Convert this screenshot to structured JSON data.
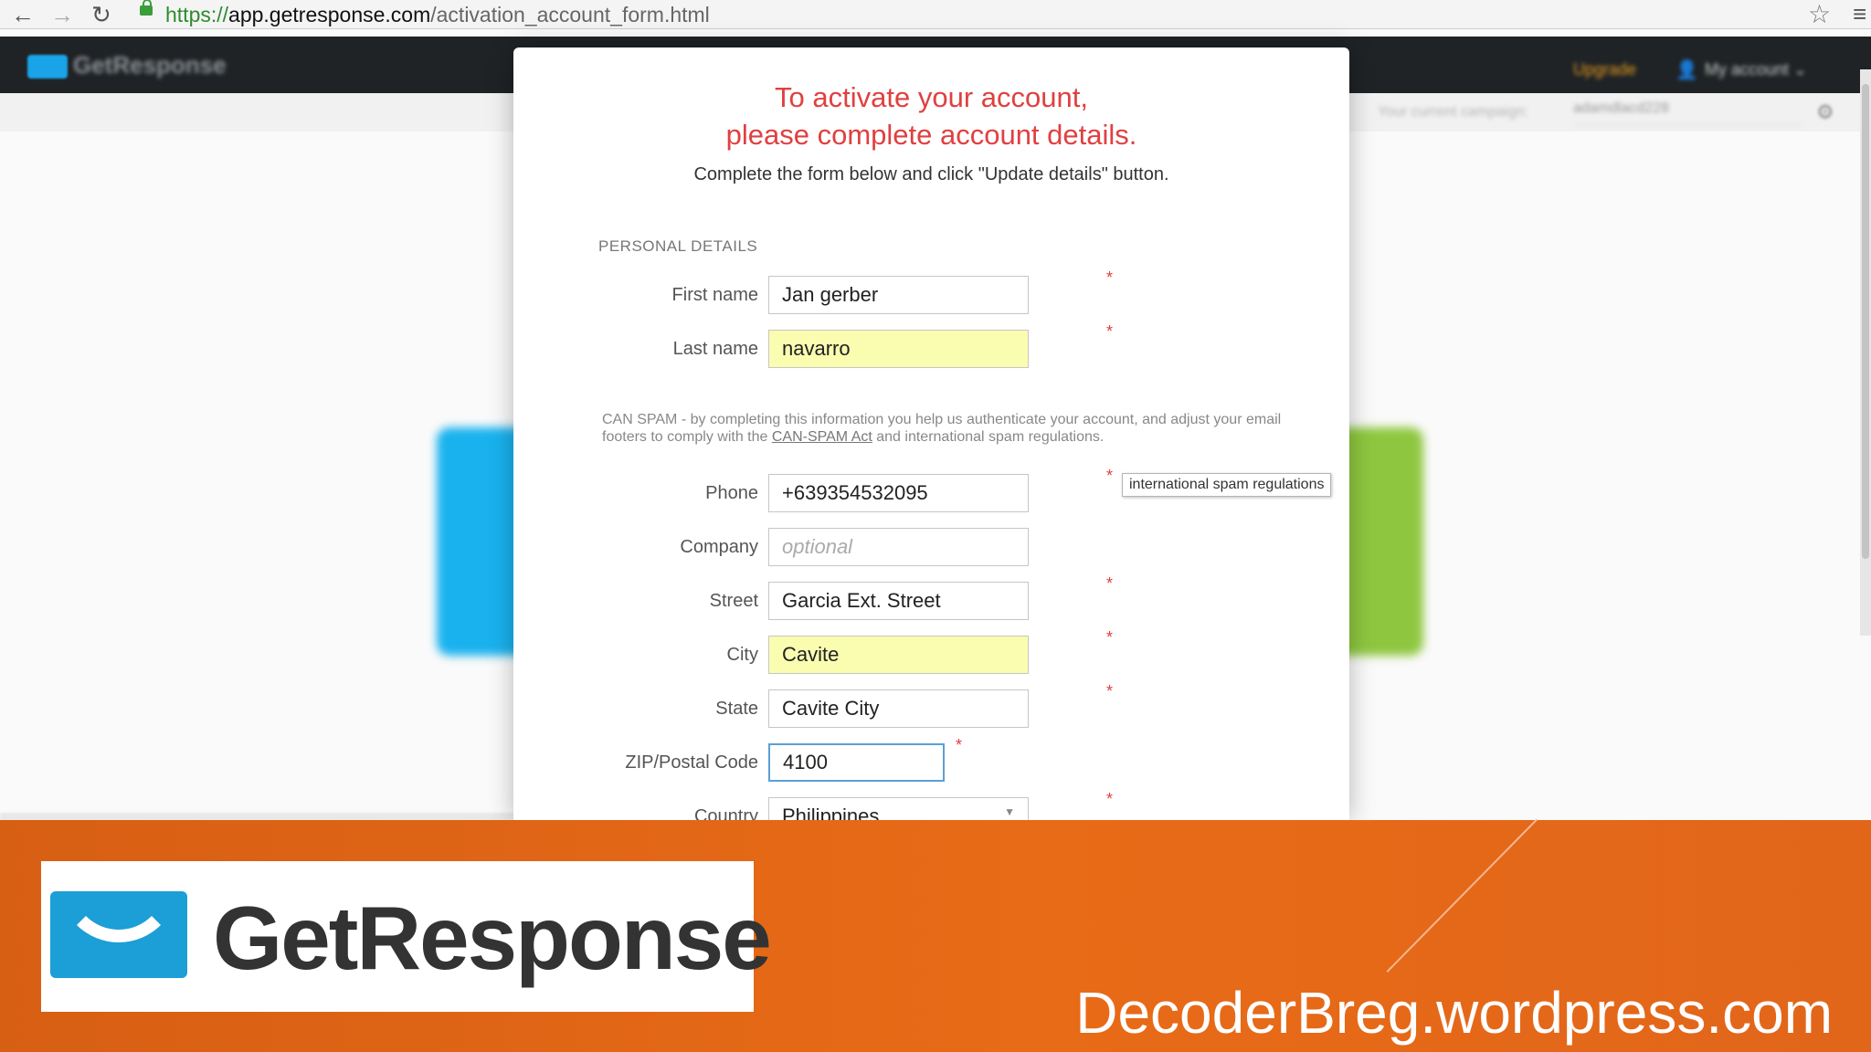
{
  "browser": {
    "url_scheme": "https://",
    "url_host": "app.getresponse.com",
    "url_path": "/activation_account_form.html",
    "back_glyph": "←",
    "forward_glyph": "→",
    "reload_glyph": "↻",
    "star_glyph": "☆",
    "menu_glyph": "≡"
  },
  "app": {
    "logo_text": "GetResponse",
    "upgrade_label": "Upgrade",
    "my_account_label": "My account ⌄",
    "user_glyph": "👤",
    "campaign_label": "Your current campaign:",
    "campaign_value": "adamdlacd228",
    "gear_glyph": "⚙"
  },
  "modal": {
    "title_line1": "To activate your account,",
    "title_line2": "please complete account details.",
    "subtitle": "Complete the form below and click \"Update details\" button.",
    "section_title": "PERSONAL DETAILS",
    "required_mark": "*",
    "fields": {
      "first_name": {
        "label": "First name",
        "value": "Jan gerber"
      },
      "last_name": {
        "label": "Last name",
        "value": "navarro"
      },
      "phone": {
        "label": "Phone",
        "value": "+639354532095"
      },
      "company": {
        "label": "Company",
        "value": "",
        "placeholder": "optional"
      },
      "street": {
        "label": "Street",
        "value": "Garcia Ext. Street"
      },
      "city": {
        "label": "City",
        "value": "Cavite"
      },
      "state": {
        "label": "State",
        "value": "Cavite City"
      },
      "zip": {
        "label": "ZIP/Postal Code",
        "value": "4100"
      },
      "country": {
        "label": "Country",
        "value": "Philippines"
      }
    },
    "spam_note_before": "CAN SPAM - by completing this information you help us authenticate your account, and adjust your email footers to comply with the ",
    "spam_link": "CAN-SPAM Act",
    "spam_note_after": " and international spam regulations.",
    "tooltip": "international spam regulations",
    "caret_glyph": "▼"
  },
  "banner": {
    "logo_text": "GetResponse",
    "site_url": "DecoderBreg.wordpress.com"
  },
  "colors": {
    "accent_red": "#e04040",
    "banner_orange": "#e86b17",
    "brand_blue": "#1c9ed7",
    "highlight_yellow": "#fafcb0"
  }
}
